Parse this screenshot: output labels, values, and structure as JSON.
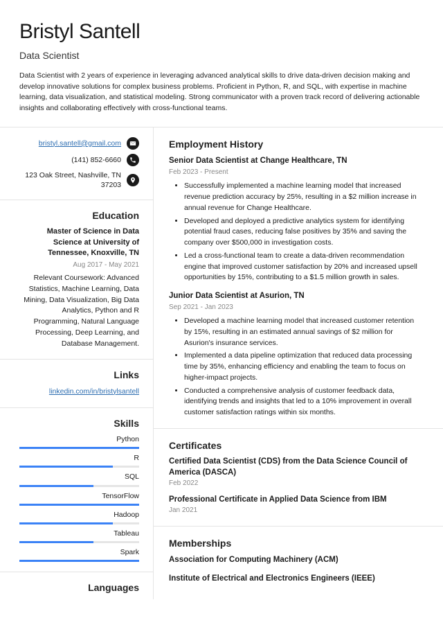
{
  "name": "Bristyl Santell",
  "title": "Data Scientist",
  "summary": "Data Scientist with 2 years of experience in leveraging advanced analytical skills to drive data-driven decision making and develop innovative solutions for complex business problems. Proficient in Python, R, and SQL, with expertise in machine learning, data visualization, and statistical modeling. Strong communicator with a proven track record of delivering actionable insights and collaborating effectively with cross-functional teams.",
  "contact": {
    "email": "bristyl.santell@gmail.com",
    "phone": "(141) 852-6660",
    "address": "123 Oak Street, Nashville, TN 37203"
  },
  "education": {
    "heading": "Education",
    "degree": "Master of Science in Data Science at University of Tennessee, Knoxville, TN",
    "dates": "Aug 2017 - May 2021",
    "body": "Relevant Coursework: Advanced Statistics, Machine Learning, Data Mining, Data Visualization, Big Data Analytics, Python and R Programming, Natural Language Processing, Deep Learning, and Database Management."
  },
  "links": {
    "heading": "Links",
    "items": [
      "linkedin.com/in/bristylsantell"
    ]
  },
  "skills": {
    "heading": "Skills",
    "items": [
      {
        "name": "Python",
        "pct": 100
      },
      {
        "name": "R",
        "pct": 78
      },
      {
        "name": "SQL",
        "pct": 62
      },
      {
        "name": "TensorFlow",
        "pct": 100
      },
      {
        "name": "Hadoop",
        "pct": 78
      },
      {
        "name": "Tableau",
        "pct": 62
      },
      {
        "name": "Spark",
        "pct": 100
      }
    ]
  },
  "languages": {
    "heading": "Languages"
  },
  "employment": {
    "heading": "Employment History",
    "jobs": [
      {
        "title": "Senior Data Scientist at Change Healthcare, TN",
        "dates": "Feb 2023 - Present",
        "bullets": [
          "Successfully implemented a machine learning model that increased revenue prediction accuracy by 25%, resulting in a $2 million increase in annual revenue for Change Healthcare.",
          "Developed and deployed a predictive analytics system for identifying potential fraud cases, reducing false positives by 35% and saving the company over $500,000 in investigation costs.",
          "Led a cross-functional team to create a data-driven recommendation engine that improved customer satisfaction by 20% and increased upsell opportunities by 15%, contributing to a $1.5 million growth in sales."
        ]
      },
      {
        "title": "Junior Data Scientist at Asurion, TN",
        "dates": "Sep 2021 - Jan 2023",
        "bullets": [
          "Developed a machine learning model that increased customer retention by 15%, resulting in an estimated annual savings of $2 million for Asurion's insurance services.",
          "Implemented a data pipeline optimization that reduced data processing time by 35%, enhancing efficiency and enabling the team to focus on higher-impact projects.",
          "Conducted a comprehensive analysis of customer feedback data, identifying trends and insights that led to a 10% improvement in overall customer satisfaction ratings within six months."
        ]
      }
    ]
  },
  "certificates": {
    "heading": "Certificates",
    "items": [
      {
        "title": "Certified Data Scientist (CDS) from the Data Science Council of America (DASCA)",
        "date": "Feb 2022"
      },
      {
        "title": "Professional Certificate in Applied Data Science from IBM",
        "date": "Jan 2021"
      }
    ]
  },
  "memberships": {
    "heading": "Memberships",
    "items": [
      "Association for Computing Machinery (ACM)",
      "Institute of Electrical and Electronics Engineers (IEEE)"
    ]
  }
}
